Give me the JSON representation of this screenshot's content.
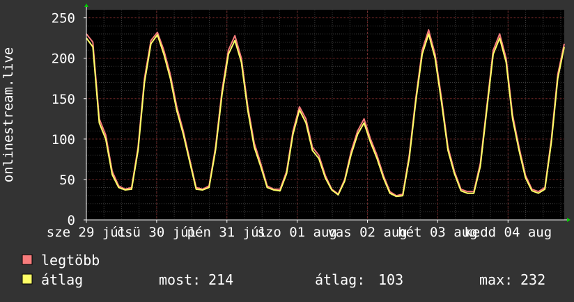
{
  "chart_data": {
    "type": "line",
    "ylabel": "onlinestream.live",
    "ylim": [
      0,
      260
    ],
    "y_ticks": [
      0,
      50,
      100,
      150,
      200,
      250
    ],
    "x_tick_labels": [
      "sze 29 júl",
      "csü 30 júl",
      "pén 31 júl",
      "szo 01 aug",
      "vas 02 aug",
      "hét 03 aug",
      "kedd 04 aug"
    ],
    "x_tick_labels_rendered": [
      "sze 29 júl",
      "csü 30 júl",
      "pén 31 júl",
      "szo 01 aug",
      "vas 02 aug",
      "hét 03 aug",
      "kedd 04 aug"
    ],
    "grid": true,
    "legend": "bottom-left",
    "colors": {
      "background": "#333333",
      "plot_background": "#000000",
      "grid_major": "#7a2a2a",
      "grid_minor": "#3a3a3a",
      "legtobb": "#f87c7c",
      "atlag": "#ffff66",
      "axis": "#ffffff",
      "arrow": "#00cc00"
    },
    "series": [
      {
        "name": "legtöbb",
        "values": [
          230,
          220,
          125,
          105,
          60,
          42,
          38,
          40,
          90,
          175,
          222,
          232,
          210,
          180,
          140,
          110,
          75,
          40,
          38,
          42,
          90,
          160,
          210,
          228,
          200,
          140,
          95,
          70,
          42,
          38,
          38,
          60,
          110,
          140,
          125,
          90,
          80,
          55,
          38,
          32,
          50,
          85,
          110,
          125,
          100,
          80,
          55,
          35,
          30,
          32,
          80,
          150,
          210,
          235,
          205,
          150,
          90,
          60,
          38,
          35,
          35,
          70,
          140,
          210,
          230,
          200,
          130,
          90,
          55,
          38,
          35,
          40,
          100,
          180,
          218
        ]
      },
      {
        "name": "átlag",
        "values": [
          225,
          214,
          120,
          100,
          56,
          40,
          37,
          38,
          86,
          170,
          218,
          229,
          205,
          175,
          135,
          106,
          72,
          38,
          37,
          40,
          86,
          155,
          205,
          222,
          195,
          135,
          90,
          66,
          40,
          37,
          36,
          57,
          106,
          136,
          120,
          86,
          76,
          52,
          37,
          31,
          48,
          81,
          106,
          120,
          96,
          76,
          52,
          33,
          29,
          30,
          76,
          146,
          205,
          230,
          200,
          145,
          86,
          57,
          36,
          33,
          33,
          66,
          136,
          205,
          225,
          195,
          125,
          86,
          52,
          36,
          33,
          38,
          96,
          175,
          214
        ]
      }
    ]
  },
  "legend": {
    "item1": "legtöbb",
    "item2": "átlag"
  },
  "stats": {
    "most_label": "most:",
    "most_value": "214",
    "atlag_label": "átlag:",
    "atlag_value": "103",
    "max_label": "max:",
    "max_value": "232"
  }
}
